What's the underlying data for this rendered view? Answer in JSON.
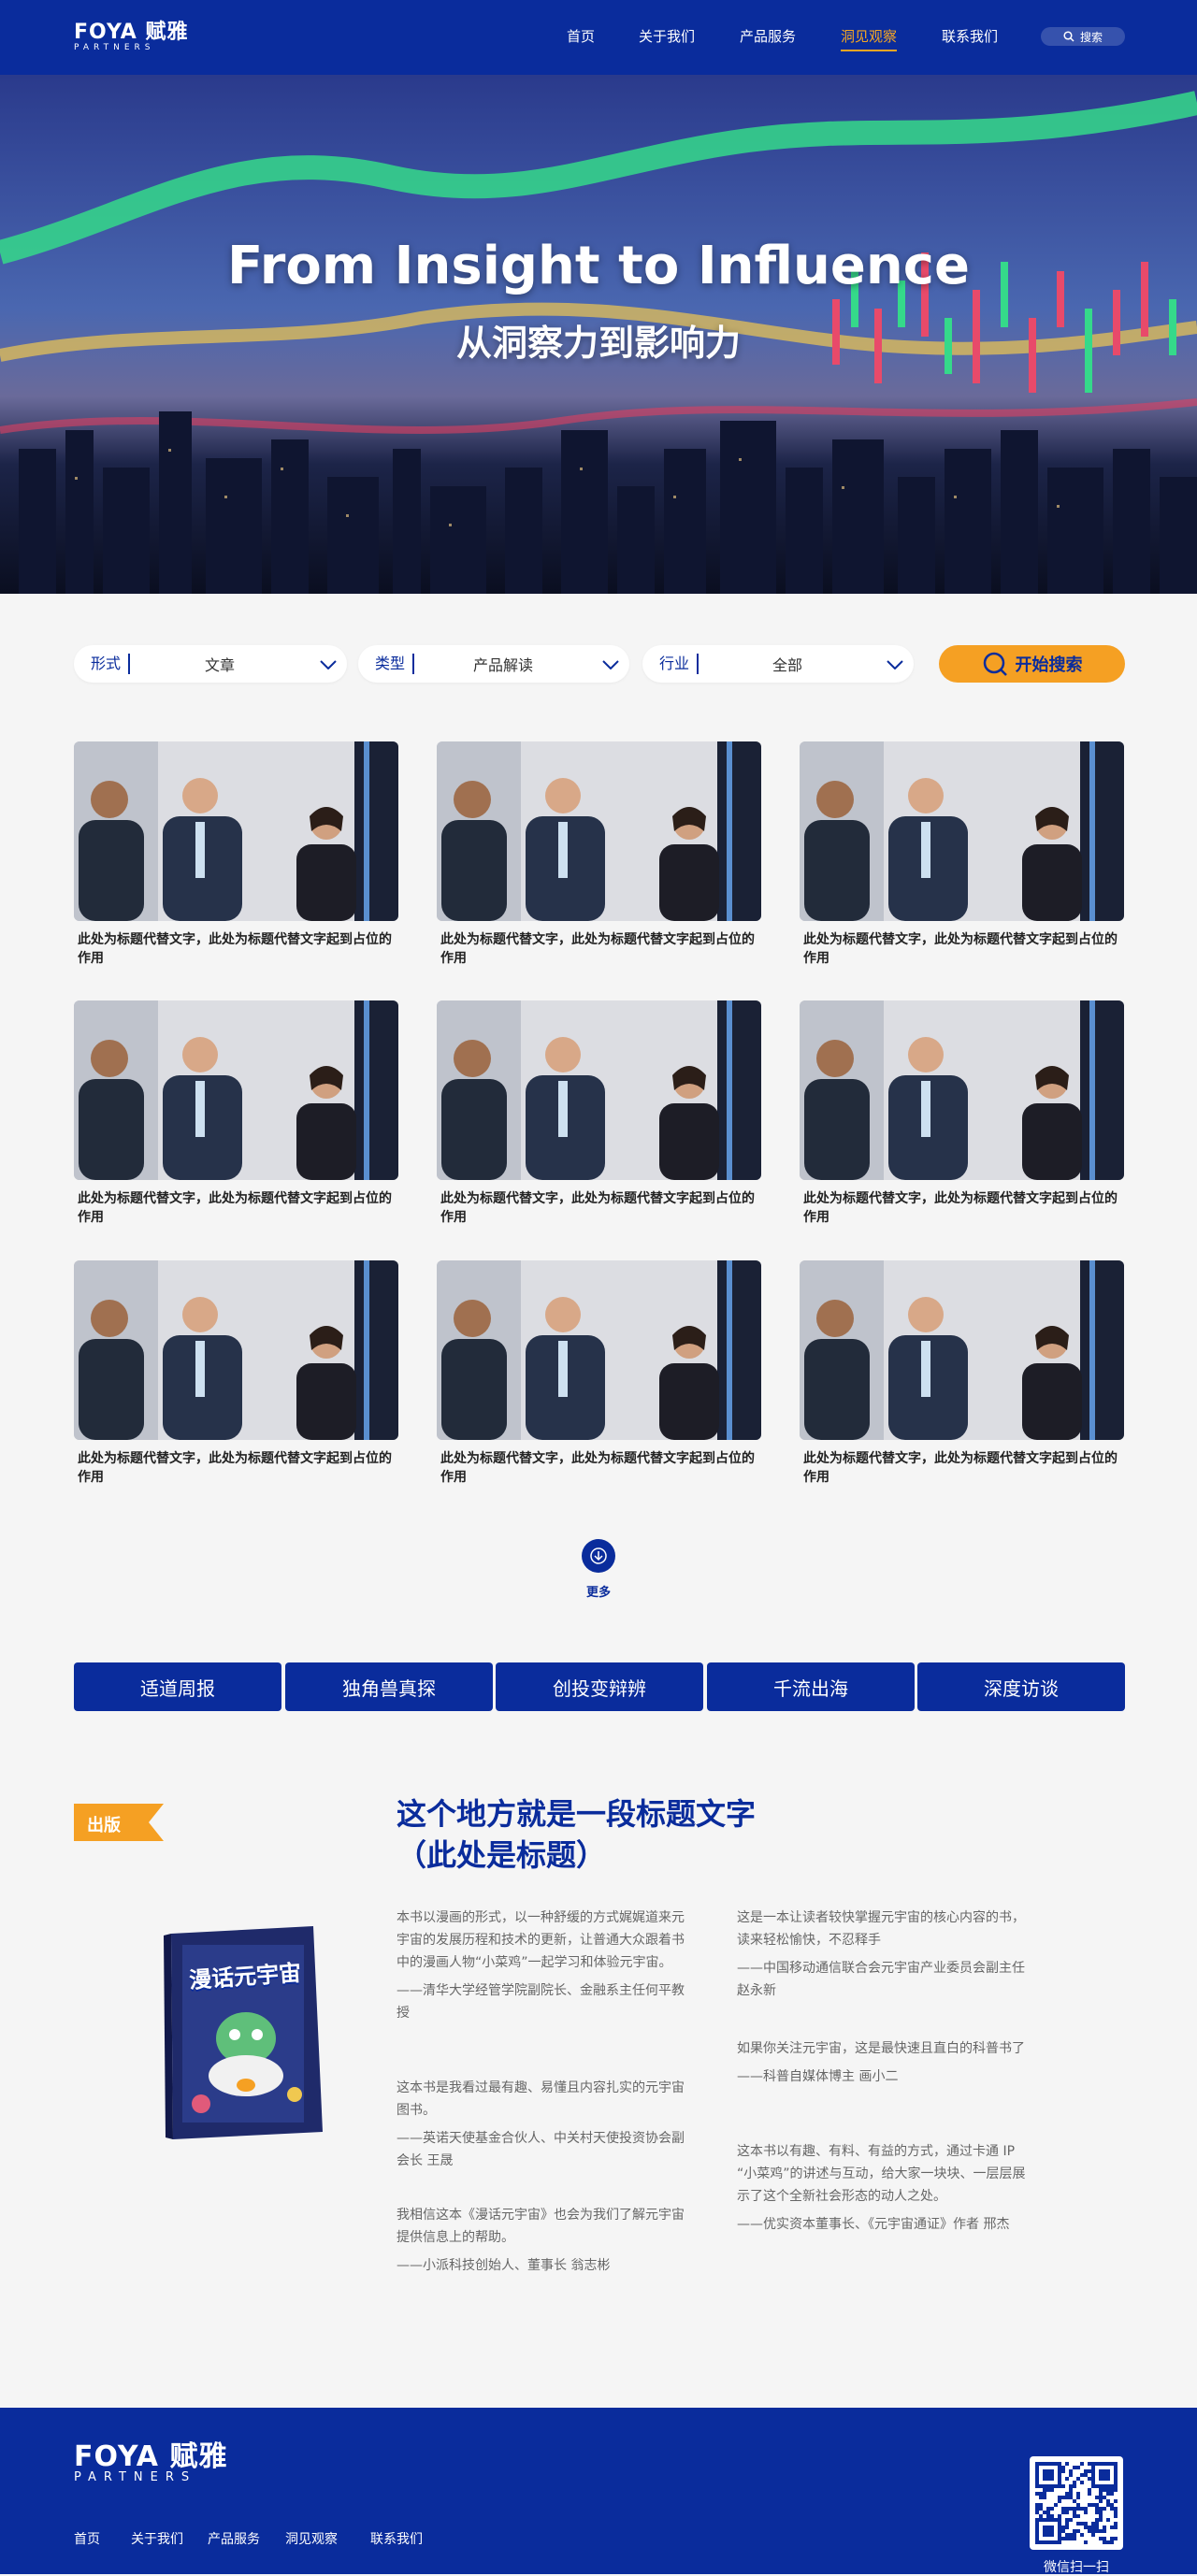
{
  "header": {
    "logo_text": "FOYA 赋雅",
    "logo_sub": "PARTNERS",
    "nav": [
      "首页",
      "关于我们",
      "产品服务",
      "洞见观察",
      "联系我们"
    ],
    "search_label": "搜索"
  },
  "hero": {
    "title": "From Insight to Influence",
    "subtitle": "从洞察力到影响力"
  },
  "filters": [
    {
      "label": "形式",
      "value": "文章"
    },
    {
      "label": "类型",
      "value": "产品解读"
    },
    {
      "label": "行业",
      "value": "全部"
    }
  ],
  "search_button": "开始搜索",
  "cards": [
    {
      "caption": "此处为标题代替文字，此处为标题代替文字起到占位的作用"
    },
    {
      "caption": "此处为标题代替文字，此处为标题代替文字起到占位的作用"
    },
    {
      "caption": "此处为标题代替文字，此处为标题代替文字起到占位的作用"
    },
    {
      "caption": "此处为标题代替文字，此处为标题代替文字起到占位的作用"
    },
    {
      "caption": "此处为标题代替文字，此处为标题代替文字起到占位的作用"
    },
    {
      "caption": "此处为标题代替文字，此处为标题代替文字起到占位的作用"
    },
    {
      "caption": "此处为标题代替文字，此处为标题代替文字起到占位的作用"
    },
    {
      "caption": "此处为标题代替文字，此处为标题代替文字起到占位的作用"
    },
    {
      "caption": "此处为标题代替文字，此处为标题代替文字起到占位的作用"
    }
  ],
  "more_label": "更多",
  "tabs": [
    "适道周报",
    "独角兽真探",
    "创投变辩辨",
    "千流出海",
    "深度访谈"
  ],
  "publication": {
    "badge": "出版",
    "title_line1": "这个地方就是一段标题文字",
    "title_line2": "（此处是标题）",
    "book_title": "漫话元宇宙",
    "quotes_left": [
      {
        "text": "本书以漫画的形式，以一种舒缓的方式娓娓道来元宇宙的发展历程和技术的更新，让普通大众跟着书中的漫画人物“小菜鸡”一起学习和体验元宇宙。",
        "source": "——清华大学经管学院副院长、金融系主任何平教授"
      },
      {
        "text": "这本书是我看过最有趣、易懂且内容扎实的元宇宙图书。",
        "source": "——英诺天使基金合伙人、中关村天使投资协会副会长 王晟"
      },
      {
        "text": "我相信这本《漫话元宇宙》也会为我们了解元宇宙提供信息上的帮助。",
        "source": "——小派科技创始人、董事长 翁志彬"
      }
    ],
    "quotes_right": [
      {
        "text": "这是一本让读者较快掌握元宇宙的核心内容的书，读来轻松愉快，不忍释手",
        "source": "——中国移动通信联合会元宇宙产业委员会副主任 赵永新"
      },
      {
        "text": "如果你关注元宇宙，这是最快速且直白的科普书了",
        "source": "——科普自媒体博主 画小二"
      },
      {
        "text": "这本书以有趣、有料、有益的方式，通过卡通 IP “小菜鸡”的讲述与互动，给大家一块块、一层层展示了这个全新社会形态的动人之处。",
        "source": "——优实资本董事长、《元宇宙通证》作者 邢杰"
      }
    ]
  },
  "footer": {
    "logo_text": "FOYA 赋雅",
    "logo_sub": "PARTNERS",
    "nav": [
      "首页",
      "关于我们",
      "产品服务",
      "洞见观察",
      "联系我们"
    ],
    "qr_label": "微信扫一扫"
  },
  "colors": {
    "brand_blue": "#0a2c9c",
    "accent_orange": "#f5a023",
    "background": "#f5f5f5"
  }
}
